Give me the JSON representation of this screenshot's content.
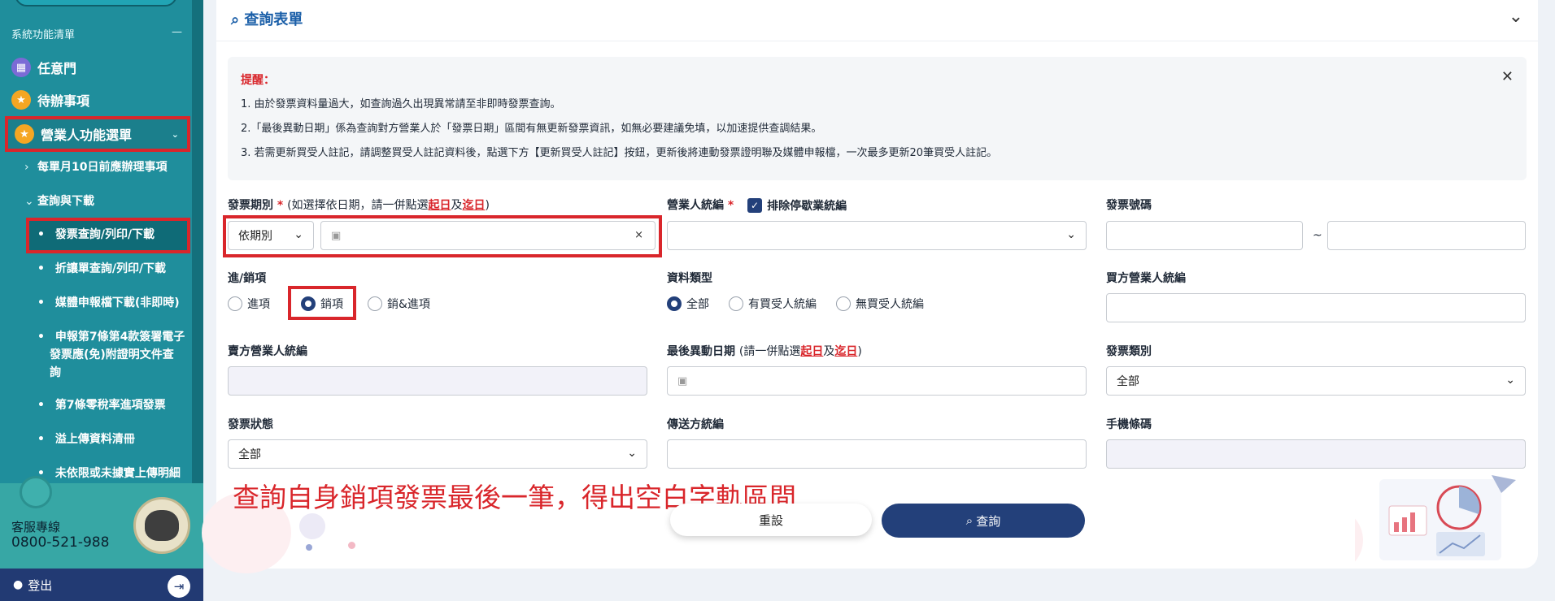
{
  "sidebar": {
    "section_title": "系統功能清單",
    "section_toggle": "—",
    "items": [
      {
        "label": "任意門"
      },
      {
        "label": "待辦事項"
      },
      {
        "label": "營業人功能選單"
      }
    ],
    "subitems": [
      {
        "label": "每單月10日前應辦理事項"
      },
      {
        "label": "查詢與下載"
      },
      {
        "label": "發票查詢/列印/下載"
      },
      {
        "label": "折讓單查詢/列印/下載"
      },
      {
        "label": "媒體申報檔下載(非即時)"
      },
      {
        "label": "申報第7條第4款簽署電子"
      },
      {
        "label": "發票應(免)附證明文件查"
      },
      {
        "label": "詢"
      },
      {
        "label": "第7條零稅率進項發票"
      },
      {
        "label": "溢上傳資料清冊"
      },
      {
        "label": "未依限或未據實上傳明細"
      }
    ],
    "hotline_label": "客服專線",
    "hotline_number": "0800-521-988",
    "logout_label": "登出"
  },
  "card": {
    "title": "查詢表單"
  },
  "notice": {
    "title": "提醒：",
    "lines": [
      "1. 由於發票資料量過大，如查詢過久出現異常請至非即時發票查詢。",
      "2.「最後異動日期」係為查詢對方營業人於「發票日期」區間有無更新發票資訊，如無必要建議免填，以加速提供查調結果。",
      "3. 若需更新買受人註記，請調整買受人註記資料後，點選下方【更新買受人註記】按鈕，更新後將連動發票證明聯及媒體申報檔，一次最多更新20筆買受人註記。"
    ]
  },
  "form": {
    "period_label": "發票期別",
    "period_hint_pre": "(如選擇依日期，請一併點選",
    "start_day": "起日",
    "and": "及",
    "end_day": "迄日",
    "period_hint_post": ")",
    "period_select": "依期別",
    "clear": "×",
    "ban_label": "營業人統編",
    "exclude_label": "排除停歇業統編",
    "invoice_no_label": "發票號碼",
    "tilde": "~",
    "inout_label": "進/銷項",
    "inout_options": [
      "進項",
      "銷項",
      "銷&進項"
    ],
    "inout_selected": "銷項",
    "datatype_label": "資料類型",
    "datatype_options": [
      "全部",
      "有買受人統編",
      "無買受人統編"
    ],
    "datatype_selected": "全部",
    "buyer_ban_label": "買方營業人統編",
    "seller_ban_label": "賣方營業人統編",
    "last_change_label": "最後異動日期",
    "last_change_hint_pre": "(請一併點選",
    "last_change_hint_post": ")",
    "invoice_type_label": "發票類別",
    "invoice_type_value": "全部",
    "status_label": "發票狀態",
    "status_value": "全部",
    "sender_ban_label": "傳送方統編",
    "mobile_barcode_label": "手機條碼"
  },
  "annotation": "查詢自身銷項發票最後一筆，得出空白字軌區間",
  "buttons": {
    "reset": "重設",
    "query": "查詢"
  }
}
